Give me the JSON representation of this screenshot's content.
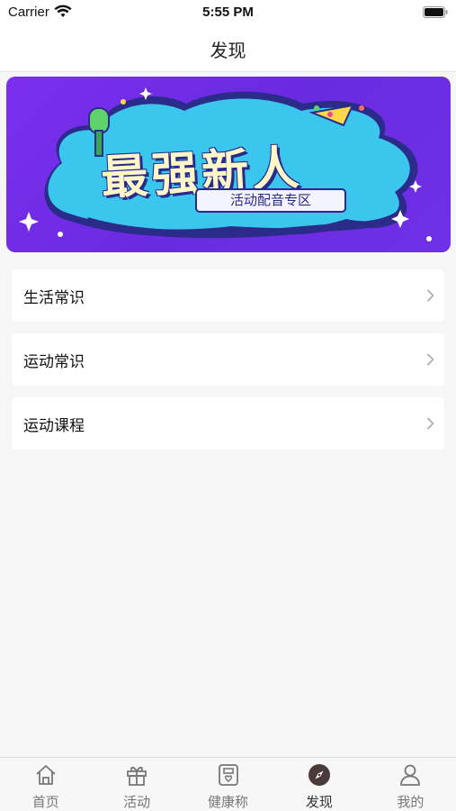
{
  "status_bar": {
    "carrier": "Carrier",
    "time": "5:55 PM"
  },
  "nav": {
    "title": "发现"
  },
  "banner": {
    "headline": "最强新人",
    "subtitle": "活动配音专区"
  },
  "menu": [
    {
      "label": "生活常识",
      "icon": "chevron-right-icon"
    },
    {
      "label": "运动常识",
      "icon": "chevron-right-icon"
    },
    {
      "label": "运动课程",
      "icon": "chevron-right-icon"
    }
  ],
  "tabs": [
    {
      "label": "首页",
      "icon": "home-icon"
    },
    {
      "label": "活动",
      "icon": "gift-icon"
    },
    {
      "label": "健康称",
      "icon": "scale-icon"
    },
    {
      "label": "发现",
      "icon": "compass-icon",
      "active": true
    },
    {
      "label": "我的",
      "icon": "person-icon"
    }
  ],
  "colors": {
    "active_tab_icon": "#4a3a3a",
    "inactive_tab": "#777777",
    "banner_bg": "#7030e8",
    "banner_water": "#3bc6ee"
  }
}
